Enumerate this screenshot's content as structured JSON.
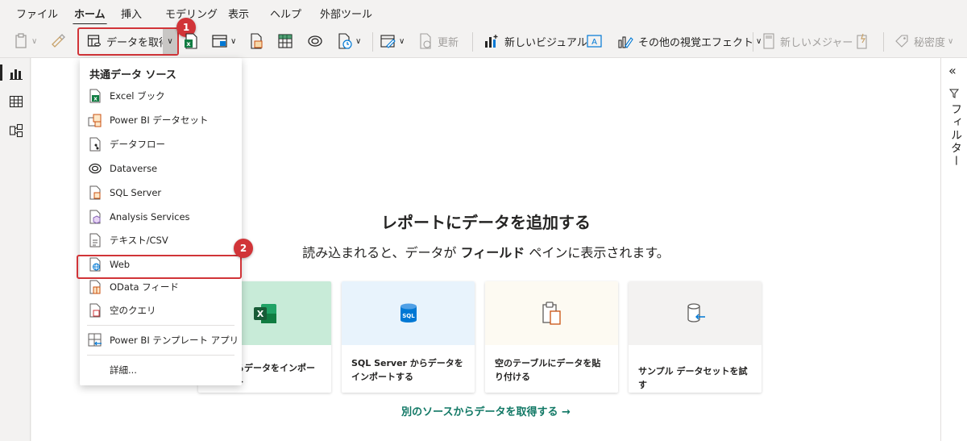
{
  "menu_tabs": [
    "ファイル",
    "ホーム",
    "挿入",
    "モデリング",
    "表示",
    "ヘルプ",
    "外部ツール"
  ],
  "ribbon": {
    "get_data_label": "データを取得",
    "refresh_label": "更新",
    "new_visual_label": "新しいビジュアル",
    "more_visuals_label": "その他の視覚エフェクト",
    "new_measure_label": "新しいメジャー",
    "sensitivity_label": "秘密度"
  },
  "badges": {
    "one": "1",
    "two": "2"
  },
  "dropdown": {
    "section_title": "共通データ ソース",
    "items": [
      {
        "label": "Excel ブック",
        "icon": "excel-icon"
      },
      {
        "label": "Power BI データセット",
        "icon": "dataset-icon"
      },
      {
        "label": "データフロー",
        "icon": "dataflow-icon"
      },
      {
        "label": "Dataverse",
        "icon": "dataverse-icon"
      },
      {
        "label": "SQL Server",
        "icon": "sql-server-icon"
      },
      {
        "label": "Analysis Services",
        "icon": "analysis-services-icon"
      },
      {
        "label": "テキスト/CSV",
        "icon": "text-csv-icon"
      },
      {
        "label": "Web",
        "icon": "web-icon"
      },
      {
        "label": "OData フィード",
        "icon": "odata-icon"
      },
      {
        "label": "空のクエリ",
        "icon": "blank-query-icon"
      }
    ],
    "template_app_label": "Power BI テンプレート アプリ",
    "more_label": "詳細..."
  },
  "canvas": {
    "heading": "レポートにデータを追加する",
    "subheading_pre": "読み込まれると、データが ",
    "subheading_bold": "フィールド",
    "subheading_post": " ペインに表示されます。",
    "cards": [
      {
        "label": "らデータをインポート",
        "color": "#c8ebd8",
        "icon": "excel-icon"
      },
      {
        "label": "SQL Server からデータをインポートする",
        "color": "#e8f3fc",
        "icon": "sql-icon"
      },
      {
        "label": "空のテーブルにデータを貼り付ける",
        "color": "#fdfaf2",
        "icon": "paste-icon"
      },
      {
        "label": "サンプル データセットを試す",
        "color": "#f3f2f1",
        "icon": "sample-dataset-icon"
      }
    ],
    "more_sources": "別のソースからデータを取得する →"
  },
  "filter_pane": {
    "label": "フィルター",
    "collapse_glyph": "«"
  },
  "colors": {
    "accent_red": "#d13438",
    "link_teal": "#117865",
    "excel_green": "#107c41"
  }
}
